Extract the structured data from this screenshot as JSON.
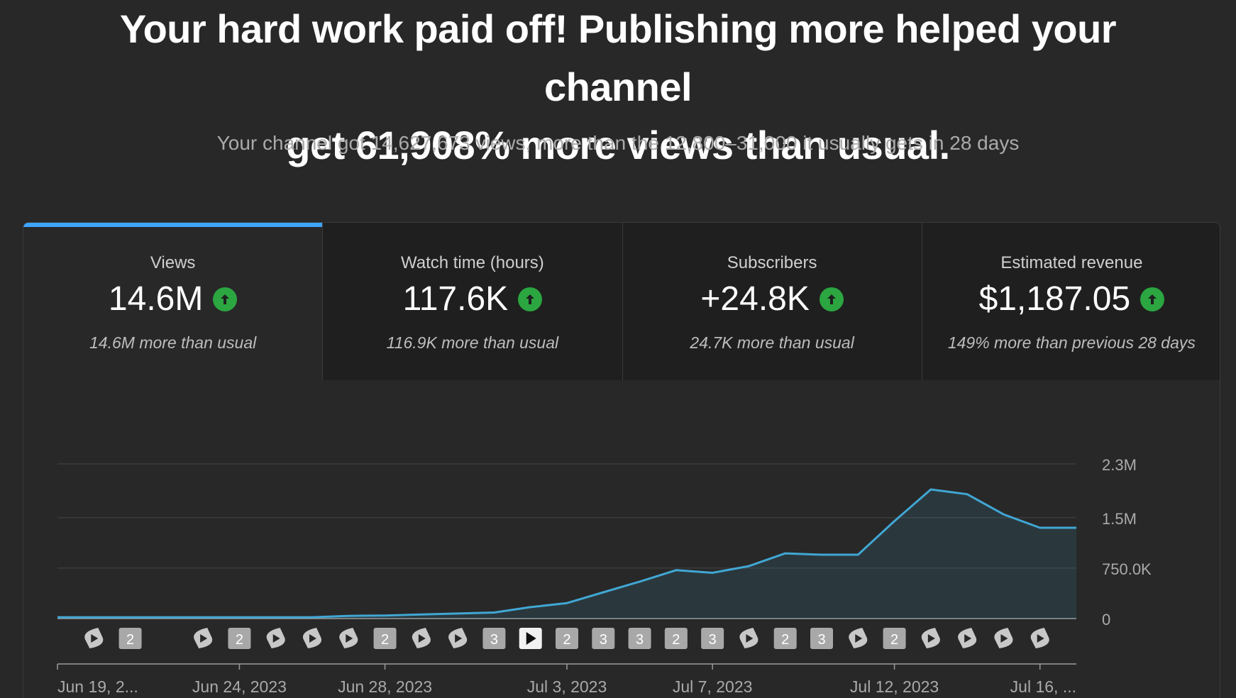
{
  "headline": {
    "line1": "Your hard work paid off! Publishing more helped your channel",
    "line2": "get 61,908% more views than usual."
  },
  "subline": "Your channel got 14,627,673 views, more than the 12,800–31,000 it usually gets in 28 days",
  "tabs": [
    {
      "label": "Views",
      "value": "14.6M",
      "note": "14.6M more than usual",
      "active": true
    },
    {
      "label": "Watch time (hours)",
      "value": "117.6K",
      "note": "116.9K more than usual",
      "active": false
    },
    {
      "label": "Subscribers",
      "value": "+24.8K",
      "note": "24.7K more than usual",
      "active": false
    },
    {
      "label": "Estimated revenue",
      "value": "$1,187.05",
      "note": "149% more than previous 28 days",
      "active": false
    }
  ],
  "colors": {
    "accent": "#3ea6ff",
    "line": "#41a7d4",
    "up": "#2ba640"
  },
  "chart_data": {
    "type": "area",
    "x": [
      "Jun 19",
      "Jun 20",
      "Jun 21",
      "Jun 22",
      "Jun 23",
      "Jun 24",
      "Jun 25",
      "Jun 26",
      "Jun 27",
      "Jun 28",
      "Jun 29",
      "Jun 30",
      "Jul 1",
      "Jul 2",
      "Jul 3",
      "Jul 4",
      "Jul 5",
      "Jul 6",
      "Jul 7",
      "Jul 8",
      "Jul 9",
      "Jul 10",
      "Jul 11",
      "Jul 12",
      "Jul 13",
      "Jul 14",
      "Jul 15",
      "Jul 16",
      "Jul 17"
    ],
    "series": [
      {
        "values": [
          20000,
          20000,
          20000,
          20000,
          20000,
          20000,
          20000,
          20000,
          40000,
          45000,
          60000,
          75000,
          90000,
          170000,
          230000,
          390000,
          550000,
          720000,
          680000,
          780000,
          970000,
          950000,
          950000,
          1450000,
          1920000,
          1850000,
          1550000,
          1350000,
          1350000
        ]
      }
    ],
    "ylim": [
      0,
      2300000
    ],
    "yticks": [
      {
        "value": 0,
        "label": "0"
      },
      {
        "value": 750000,
        "label": "750.0K"
      },
      {
        "value": 1500000,
        "label": "1.5M"
      },
      {
        "value": 2300000,
        "label": "2.3M"
      }
    ],
    "xticks": [
      {
        "index": 0,
        "label": "Jun 19, 2..."
      },
      {
        "index": 5,
        "label": "Jun 24, 2023"
      },
      {
        "index": 9,
        "label": "Jun 28, 2023"
      },
      {
        "index": 14,
        "label": "Jul 3, 2023"
      },
      {
        "index": 18,
        "label": "Jul 7, 2023"
      },
      {
        "index": 23,
        "label": "Jul 12, 2023"
      },
      {
        "index": 27,
        "label": "Jul 16, ..."
      }
    ],
    "markers": [
      {
        "index": 1,
        "kind": "shorts"
      },
      {
        "index": 2,
        "kind": "count",
        "label": "2"
      },
      {
        "index": 4,
        "kind": "shorts"
      },
      {
        "index": 5,
        "kind": "count",
        "label": "2"
      },
      {
        "index": 6,
        "kind": "shorts"
      },
      {
        "index": 7,
        "kind": "shorts"
      },
      {
        "index": 8,
        "kind": "shorts"
      },
      {
        "index": 9,
        "kind": "count",
        "label": "2"
      },
      {
        "index": 10,
        "kind": "shorts"
      },
      {
        "index": 11,
        "kind": "shorts"
      },
      {
        "index": 12,
        "kind": "count",
        "label": "3"
      },
      {
        "index": 13,
        "kind": "video"
      },
      {
        "index": 14,
        "kind": "count",
        "label": "2"
      },
      {
        "index": 15,
        "kind": "count",
        "label": "3"
      },
      {
        "index": 16,
        "kind": "count",
        "label": "3"
      },
      {
        "index": 17,
        "kind": "count",
        "label": "2"
      },
      {
        "index": 18,
        "kind": "count",
        "label": "3"
      },
      {
        "index": 19,
        "kind": "shorts"
      },
      {
        "index": 20,
        "kind": "count",
        "label": "2"
      },
      {
        "index": 21,
        "kind": "count",
        "label": "3"
      },
      {
        "index": 22,
        "kind": "shorts"
      },
      {
        "index": 23,
        "kind": "count",
        "label": "2"
      },
      {
        "index": 24,
        "kind": "shorts"
      },
      {
        "index": 25,
        "kind": "shorts"
      },
      {
        "index": 26,
        "kind": "shorts"
      },
      {
        "index": 27,
        "kind": "shorts"
      }
    ]
  }
}
